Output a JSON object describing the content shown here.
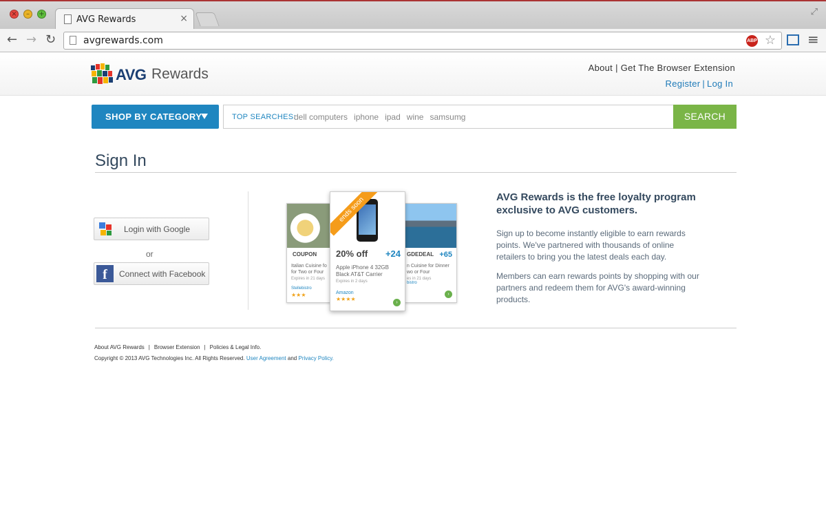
{
  "browser": {
    "tab_title": "AVG Rewards",
    "tab_close": "×",
    "url": "avgrewards.com",
    "adblock_label": "ABP",
    "icons": [
      "back-arrow-icon",
      "forward-arrow-icon",
      "reload-icon",
      "star-icon",
      "menu-icon"
    ]
  },
  "header": {
    "brand": "AVG",
    "brand_sub": "Rewards",
    "about": "About",
    "extension": "Get The Browser Extension",
    "register": "Register",
    "login": "Log In",
    "separator": "|"
  },
  "search": {
    "category_label": "SHOP BY CATEGORY",
    "top_label": "TOP SEARCHES:",
    "terms": [
      "dell computers",
      "iphone",
      "ipad",
      "wine",
      "samsumg"
    ],
    "button": "SEARCH"
  },
  "signin": {
    "title": "Sign In",
    "google": "Login with Google",
    "or": "or",
    "facebook": "Connect with Facebook"
  },
  "cards": {
    "left": {
      "type": "COUPON",
      "desc1": "Italian Cuisine fo",
      "desc2": "for Two or Four",
      "expires": "Expires in 21 days",
      "merchant": "Stellebistro",
      "stars": "★★★"
    },
    "center": {
      "ribbon": "ends soon",
      "discount": "20% off",
      "points": "+24",
      "desc1": "Apple iPhone 4 32GB",
      "desc2": "Black AT&T Carrier",
      "expires": "Expires in 2 days",
      "merchant": "Amazon",
      "stars": "★★★★",
      "go": "›"
    },
    "right": {
      "type": "GDEDEAL",
      "points": "+65",
      "desc1": "n Cuisine for Dinner",
      "desc2": "wo or Four",
      "expires": "es in 21 days",
      "merchant": "bistro",
      "go": "›"
    }
  },
  "promo": {
    "heading": "AVG Rewards is the free loyalty program exclusive to AVG customers.",
    "p1": "Sign up to become instantly eligible to earn rewards points. We've partnered with thousands of online retailers to bring you the latest deals each day.",
    "p2": "Members can earn rewards points by shopping with our partners and redeem them for AVG's award-winning products."
  },
  "footer": {
    "links": [
      "About AVG Rewards",
      "Browser Extension",
      "Policies & Legal Info."
    ],
    "separator": "|",
    "copyright": "Copyright © 2013 AVG Technologies Inc. All Rights Reserved.",
    "user_agreement": "User Agreement",
    "and": "and",
    "privacy": "Privacy Policy."
  },
  "colors": {
    "accent_blue": "#1f86c0",
    "search_green": "#7ab547",
    "heading": "#34495e"
  }
}
